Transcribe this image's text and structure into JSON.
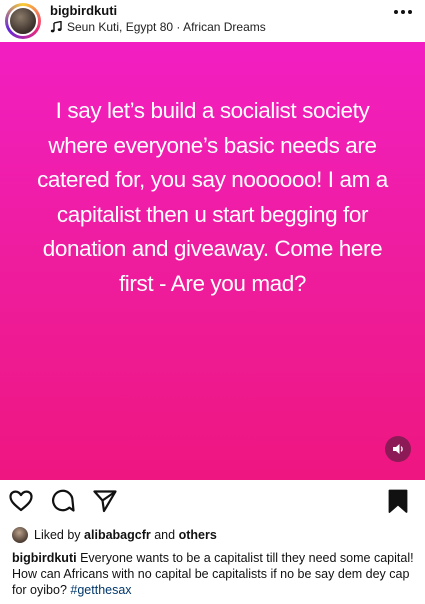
{
  "post": {
    "username": "bigbirdkuti",
    "audio": "Seun Kuti, Egypt 80 · African Dreams",
    "quote": "I say let’s build a socialist society\nwhere everyone’s basic needs are\ncatered for, you say noooooo! I am a\ncapitalist then u start begging for\ndonation and giveaway. Come here\nfirst - Are you mad?"
  },
  "likes": {
    "prefix": "Liked by",
    "liker": "alibabagcfr",
    "and": "and",
    "others": "others"
  },
  "caption": {
    "username": "bigbirdkuti",
    "text": "Everyone wants to be a capitalist till they need some capital! How can Africans with no capital be capitalists if no be say dem dey cap for oyibo?",
    "hashtag": "#getthesax"
  },
  "icons": {
    "music": "music-note-icon",
    "more": "more-options-icon",
    "sound": "speaker-icon",
    "like": "heart-icon",
    "comment": "comment-icon",
    "share": "send-icon",
    "save": "bookmark-icon"
  },
  "colors": {
    "post_gradient_top": "#f21ec2",
    "post_gradient_bottom": "#ee1680",
    "hashtag": "#00376b"
  }
}
